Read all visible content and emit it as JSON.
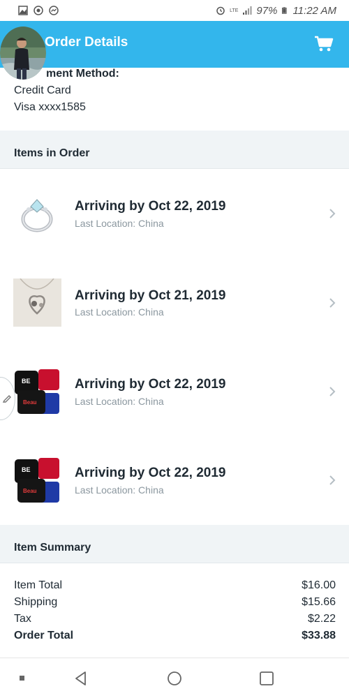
{
  "status_bar": {
    "battery": "97%",
    "time": "11:22 AM",
    "network": "LTE",
    "left_icons": [
      "gallery-icon",
      "chrome-icon",
      "messenger-icon"
    ],
    "right_icons": [
      "alarm-icon",
      "signal-icon",
      "battery-icon"
    ]
  },
  "header": {
    "title": "Order Details",
    "cart_icon": "cart-icon",
    "color": "#33b6ec"
  },
  "payment": {
    "label": "Payment Method:",
    "label_visible": "ment Method:",
    "method": "Credit Card",
    "card": "Visa xxxx1585"
  },
  "items_section": {
    "title": "Items in Order"
  },
  "items": [
    {
      "title": "Arriving by Oct 22, 2019",
      "subtitle": "Last Location: China",
      "thumb": "ring-image"
    },
    {
      "title": "Arriving by Oct 21, 2019",
      "subtitle": "Last Location: China",
      "thumb": "necklace-image"
    },
    {
      "title": "Arriving by Oct 22, 2019",
      "subtitle": "Last Location: China",
      "thumb": "hoodies-image"
    },
    {
      "title": "Arriving by Oct 22, 2019",
      "subtitle": "Last Location: China",
      "thumb": "hoodies-image"
    }
  ],
  "summary_section": {
    "title": "Item Summary"
  },
  "summary": {
    "item_total_label": "Item Total",
    "item_total_value": "$16.00",
    "shipping_label": "Shipping",
    "shipping_value": "$15.66",
    "tax_label": "Tax",
    "tax_value": "$2.22",
    "order_total_label": "Order Total",
    "order_total_value": "$33.88"
  },
  "nav_bar": {
    "buttons": [
      "recent-dot-icon",
      "back-icon",
      "home-icon",
      "overview-icon"
    ]
  }
}
